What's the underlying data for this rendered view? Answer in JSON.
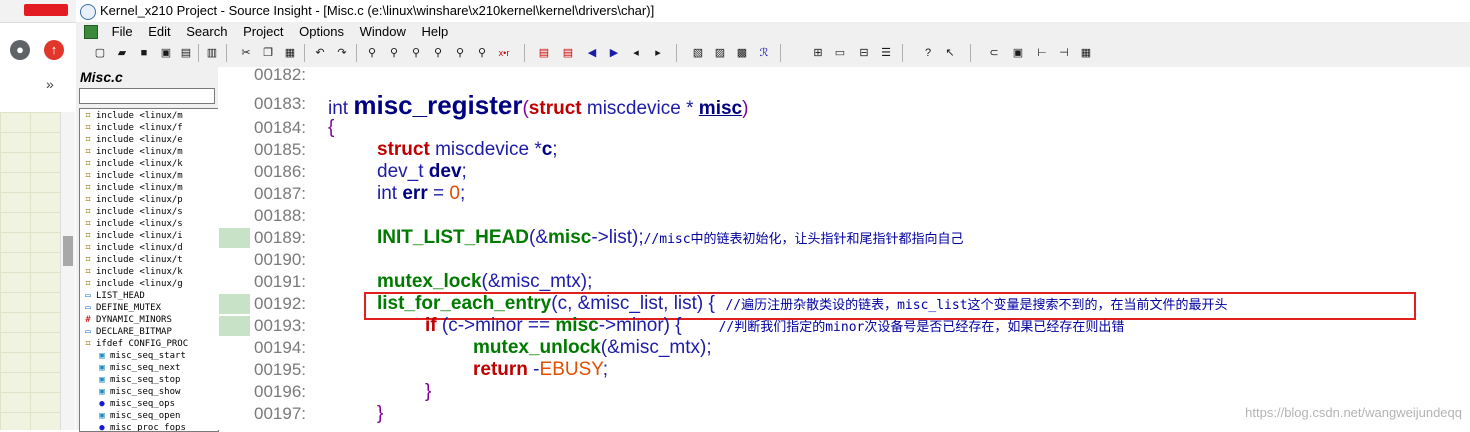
{
  "window": {
    "title": "Kernel_x210 Project - Source Insight - [Misc.c (e:\\linux\\winshare\\x210kernel\\kernel\\drivers\\char)]"
  },
  "menu": [
    "File",
    "Edit",
    "Search",
    "Project",
    "View",
    "Window",
    "Help"
  ],
  "symbol_panel": {
    "file_name": "Misc.c",
    "items": [
      {
        "icon": "include-icon",
        "label": "include <linux/m"
      },
      {
        "icon": "include-icon",
        "label": "include <linux/f"
      },
      {
        "icon": "include-icon",
        "label": "include <linux/e"
      },
      {
        "icon": "include-icon",
        "label": "include <linux/m"
      },
      {
        "icon": "include-icon",
        "label": "include <linux/k"
      },
      {
        "icon": "include-icon",
        "label": "include <linux/m"
      },
      {
        "icon": "include-icon",
        "label": "include <linux/m"
      },
      {
        "icon": "include-icon",
        "label": "include <linux/p"
      },
      {
        "icon": "include-icon",
        "label": "include <linux/s"
      },
      {
        "icon": "include-icon",
        "label": "include <linux/s"
      },
      {
        "icon": "include-icon",
        "label": "include <linux/i"
      },
      {
        "icon": "include-icon",
        "label": "include <linux/d"
      },
      {
        "icon": "include-icon",
        "label": "include <linux/t"
      },
      {
        "icon": "include-icon",
        "label": "include <linux/k"
      },
      {
        "icon": "include-icon",
        "label": "include <linux/g"
      },
      {
        "icon": "list-icon",
        "label": "LIST_HEAD"
      },
      {
        "icon": "define-icon",
        "label": "DEFINE_MUTEX"
      },
      {
        "icon": "hash-icon",
        "label": "DYNAMIC_MINORS"
      },
      {
        "icon": "list-icon",
        "label": "DECLARE_BITMAP"
      },
      {
        "icon": "include-icon",
        "label": "ifdef CONFIG_PROC"
      },
      {
        "icon": "function-icon",
        "label": "misc_seq_start"
      },
      {
        "icon": "function-icon",
        "label": "misc_seq_next"
      },
      {
        "icon": "function-icon",
        "label": "misc_seq_stop"
      },
      {
        "icon": "function-icon",
        "label": "misc_seq_show"
      },
      {
        "icon": "struct-icon",
        "label": "misc_seq_ops"
      },
      {
        "icon": "function-icon",
        "label": "misc_seq_open"
      },
      {
        "icon": "struct-icon",
        "label": "misc_proc_fops"
      }
    ]
  },
  "editor": {
    "lines": [
      {
        "num": "00182:"
      },
      {
        "num": "00183:",
        "parts": [
          "int",
          "misc_register",
          "(",
          "struct",
          "miscdevice * ",
          "misc",
          ")"
        ]
      },
      {
        "num": "00184:",
        "parts": [
          "{"
        ]
      },
      {
        "num": "00185:",
        "parts": [
          "struct",
          " miscdevice *",
          "c",
          ";"
        ]
      },
      {
        "num": "00186:",
        "parts": [
          "dev_t ",
          "dev",
          ";"
        ]
      },
      {
        "num": "00187:",
        "parts": [
          "int ",
          "err",
          " = ",
          "0",
          ";"
        ]
      },
      {
        "num": "00188:"
      },
      {
        "num": "00189:",
        "parts": [
          "INIT_LIST_HEAD",
          "(&",
          "misc",
          "->list);",
          "//misc中的链表初始化，让头指针和尾指针都指向自己"
        ]
      },
      {
        "num": "00190:"
      },
      {
        "num": "00191:",
        "parts": [
          "mutex_lock",
          "(&misc_mtx);"
        ]
      },
      {
        "num": "00192:",
        "parts": [
          "list_for_each_entry",
          "(c, &misc_list, list) {",
          "//遍历注册杂散类设的链表，misc_list这个变量是搜索不到的，在当前文件的最开头"
        ]
      },
      {
        "num": "00193:",
        "parts": [
          "if",
          " (c->minor == ",
          "misc",
          "->minor) {",
          "//判断我们指定的minor次设备号是否已经存在，如果已经存在则出错"
        ]
      },
      {
        "num": "00194:",
        "parts": [
          "mutex_unlock",
          "(&misc_mtx);"
        ]
      },
      {
        "num": "00195:",
        "parts": [
          "return",
          " -",
          "EBUSY",
          ";"
        ]
      },
      {
        "num": "00196:",
        "parts": [
          "}"
        ]
      },
      {
        "num": "00197:",
        "parts": [
          "}"
        ]
      }
    ]
  },
  "watermark": "https://blog.csdn.net/wangweijundeqq",
  "colors": {
    "highlight_box": "#e0201c",
    "gutter_mark": "#c8e2c8"
  }
}
